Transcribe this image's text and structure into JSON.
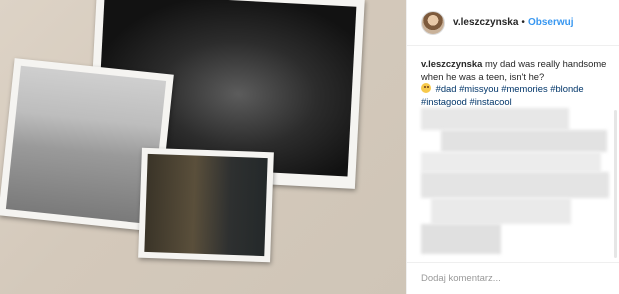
{
  "header": {
    "username": "v.leszczynska",
    "separator": "•",
    "follow_label": "Obserwuj",
    "avatar_icon": "profile-avatar"
  },
  "caption": {
    "username": "v.leszczynska",
    "text": "my dad was really handsome when he was a teen, isn't he?",
    "emoji_icon": "smiling-face-with-heart-eyes",
    "hashtags": "#dad #missyou #memories #blonde #instagood #instacool"
  },
  "comment_box": {
    "placeholder": "Dodaj komentarz..."
  },
  "colors": {
    "accent": "#3897f0",
    "hashtag": "#003569",
    "text": "#262626",
    "border": "#efefef"
  }
}
